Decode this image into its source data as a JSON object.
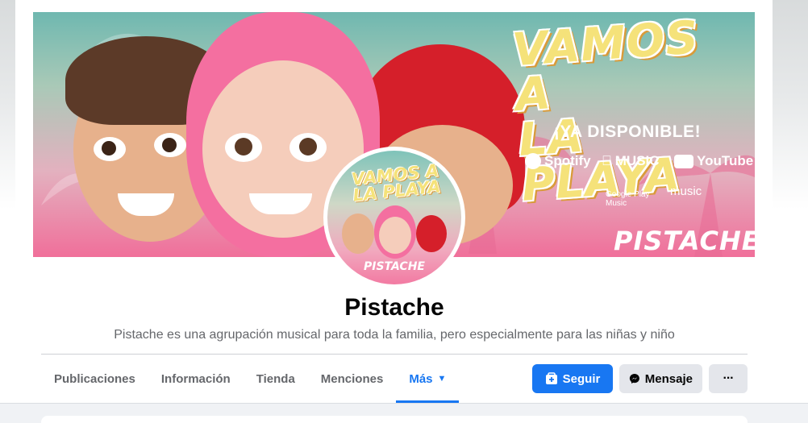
{
  "cover": {
    "headline_line1": "VAMOS A",
    "headline_line2": "LA PLAYA",
    "available": "¡YA DISPONIBLE!",
    "services": {
      "spotify": "Spotify",
      "apple_music": "MUSIC",
      "youtube": "YouTube",
      "google_play_line1": "Google Play",
      "google_play_line2": "Music",
      "amazon_music": "music"
    },
    "brand": "PISTACHE"
  },
  "avatar": {
    "headline_line1": "VAMOS A",
    "headline_line2": "LA PLAYA",
    "brand": "PISTACHE"
  },
  "page": {
    "title": "Pistache",
    "description": "Pistache es una agrupación musical para toda la familia, pero especialmente para las niñas y niño"
  },
  "tabs": [
    {
      "label": "Publicaciones"
    },
    {
      "label": "Información"
    },
    {
      "label": "Tienda"
    },
    {
      "label": "Menciones"
    },
    {
      "label": "Más"
    }
  ],
  "actions": {
    "follow": "Seguir",
    "message": "Mensaje",
    "more": "···"
  },
  "colors": {
    "accent": "#1877f2",
    "secondary_button": "#e4e6eb",
    "muted_text": "#65676b"
  },
  "icons": {
    "follow": "follow-icon",
    "message": "messenger-icon",
    "more_tab": "caret-down-icon"
  }
}
